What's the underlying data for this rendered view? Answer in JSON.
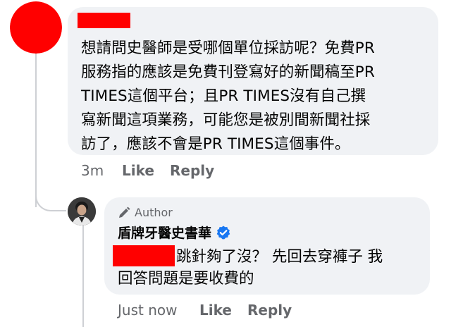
{
  "colors": {
    "redaction": "#ff0000",
    "bubble": "#f0f2f5",
    "verified_badge": "#1877f2",
    "meta_text": "#65676b"
  },
  "comment1": {
    "lines": [
      "想請問史醫師是受哪個單位採訪呢？免費PR",
      "服務指的應該是免費刊登寫好的新聞稿至PR",
      "TIMES這個平台；且PR TIMES沒有自己撰",
      "寫新聞這項業務，可能您是被別間新聞社採",
      "訪了，應該不會是PR TIMES這個事件。"
    ],
    "time": "3m",
    "like_label": "Like",
    "reply_label": "Reply"
  },
  "comment2": {
    "author_badge": "Author",
    "author_badge_icon": "pen-icon",
    "author_name": "盾牌牙醫史書華",
    "verified_icon": "verified-check-icon",
    "text_line1": "跳針夠了沒？ 先回去穿褲子 我",
    "text_line2": "回答問題是要收費的",
    "time": "Just now",
    "like_label": "Like",
    "reply_label": "Reply"
  }
}
